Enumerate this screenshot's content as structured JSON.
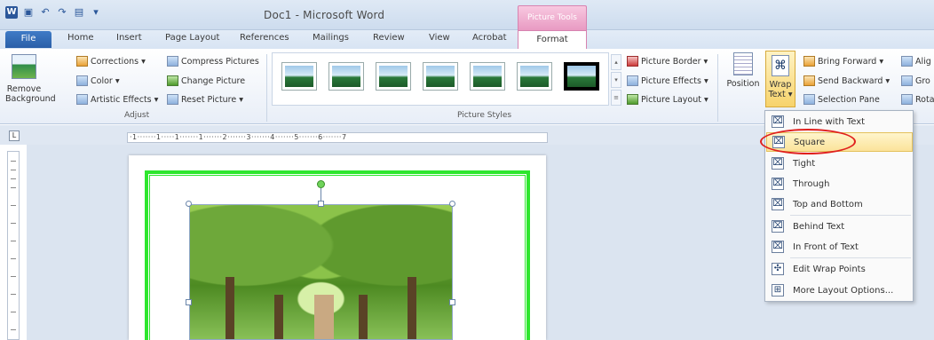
{
  "window": {
    "title": "Doc1 - Microsoft Word",
    "context_tab_group": "Picture Tools"
  },
  "qat": {
    "app_icon": "W",
    "save_icon": "save-icon",
    "undo_icon": "undo-icon",
    "redo_icon": "redo-icon",
    "print_preview_icon": "print-preview-icon"
  },
  "tabs": [
    "File",
    "Home",
    "Insert",
    "Page Layout",
    "References",
    "Mailings",
    "Review",
    "View",
    "Acrobat",
    "Format"
  ],
  "ribbon": {
    "remove_background": "Remove Background",
    "corrections": "Corrections ▾",
    "color": "Color ▾",
    "artistic_effects": "Artistic Effects ▾",
    "compress_pictures": "Compress Pictures",
    "change_picture": "Change Picture",
    "reset_picture": "Reset Picture ▾",
    "group_adjust": "Adjust",
    "group_picture_styles": "Picture Styles",
    "picture_border": "Picture Border ▾",
    "picture_effects": "Picture Effects ▾",
    "picture_layout": "Picture Layout ▾",
    "position": "Position",
    "wrap_text": "Wrap Text ▾",
    "bring_forward": "Bring Forward ▾",
    "send_backward": "Send Backward ▾",
    "selection_pane": "Selection Pane",
    "align": "Alig",
    "group": "Gro",
    "rotate": "Rota"
  },
  "ruler": {
    "corner": "L",
    "text": "·1·······1·····1·······1·······2·······3·······4·······5·······6·······7"
  },
  "wrap_menu": {
    "items": [
      "In Line with Text",
      "Square",
      "Tight",
      "Through",
      "Top and Bottom",
      "Behind Text",
      "In Front of Text",
      "Edit Wrap Points",
      "More Layout Options..."
    ],
    "selected": "Square"
  },
  "colors": {
    "accent": "#2b579a",
    "picture_tools": "#e89ac2",
    "highlight_ellipse": "#e0201e",
    "frame": "#2ee62e"
  }
}
